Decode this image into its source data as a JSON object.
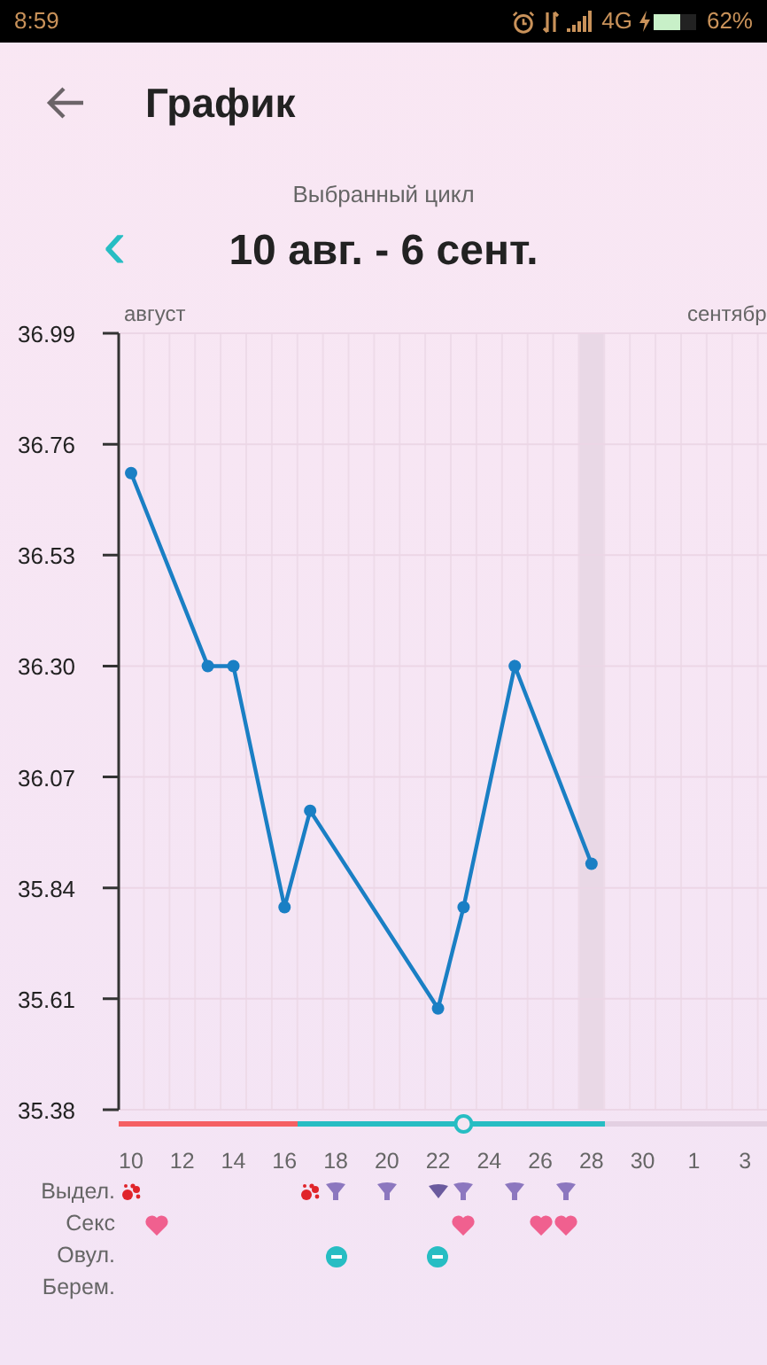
{
  "status_bar": {
    "time": "8:59",
    "network": "4G",
    "battery": "62%"
  },
  "header": {
    "title": "График"
  },
  "cycle": {
    "caption": "Выбранный цикл",
    "range": "10 авг. - 6 сент.",
    "prev": "‹"
  },
  "graph": {
    "month_labels": [
      "август",
      "сентябр"
    ],
    "chart_data": {
      "type": "line",
      "categories": [
        "10",
        null,
        "12",
        null,
        "14",
        null,
        "16",
        null,
        "18",
        null,
        "20",
        null,
        "22",
        null,
        "24",
        null,
        "26",
        null,
        "28",
        null,
        "30",
        null,
        "1",
        null,
        "3"
      ],
      "grid": true,
      "series": [
        {
          "color": "#1a7fc4",
          "marker": true,
          "values": [
            36.7,
            null,
            null,
            36.3,
            36.3,
            null,
            35.8,
            36.0,
            null,
            null,
            null,
            null,
            35.59,
            35.8,
            null,
            36.3,
            null,
            null,
            35.89,
            null,
            null,
            null,
            null,
            null,
            null
          ]
        }
      ],
      "ylim": [
        35.38,
        36.99
      ],
      "yticks": [
        {
          "value": 36.99,
          "label": "36.99"
        },
        {
          "value": 36.76,
          "label": "36.76"
        },
        {
          "value": 36.53,
          "label": "36.53"
        },
        {
          "value": 36.3,
          "label": "36.30"
        },
        {
          "value": 36.07,
          "label": "36.07"
        },
        {
          "value": 35.84,
          "label": "35.84"
        },
        {
          "value": 35.61,
          "label": "35.61"
        },
        {
          "value": 35.38,
          "label": "35.38"
        }
      ]
    },
    "cycle_bar": {
      "segments": [
        {
          "color": "#27bdc3",
          "level": 0.75
        },
        {
          "color": "#f55f63",
          "level": 0.276
        }
      ],
      "marker": {
        "level": 0.532
      }
    }
  },
  "symbol_rows": [
    {
      "label": "Выдел.",
      "cells": [
        {
          "kind": "blood"
        },
        {
          "kind": "empty"
        },
        {
          "kind": "empty"
        },
        {
          "kind": "empty"
        },
        {
          "kind": "empty"
        },
        {
          "kind": "empty"
        },
        {
          "kind": "empty"
        },
        {
          "kind": "blood"
        },
        {
          "kind": "drop"
        },
        {
          "kind": "empty"
        },
        {
          "kind": "drop"
        },
        {
          "kind": "empty"
        },
        {
          "kind": "drop_dark"
        },
        {
          "kind": "drop"
        },
        {
          "kind": "empty"
        },
        {
          "kind": "drop"
        },
        {
          "kind": "empty"
        },
        {
          "kind": "drop"
        }
      ]
    },
    {
      "label": "Секс",
      "cells": [
        {
          "kind": "empty"
        },
        {
          "kind": "heart"
        },
        {
          "kind": "empty"
        },
        {
          "kind": "empty"
        },
        {
          "kind": "empty"
        },
        {
          "kind": "empty"
        },
        {
          "kind": "empty"
        },
        {
          "kind": "empty"
        },
        {
          "kind": "empty"
        },
        {
          "kind": "empty"
        },
        {
          "kind": "empty"
        },
        {
          "kind": "empty"
        },
        {
          "kind": "empty"
        },
        {
          "kind": "heart"
        },
        {
          "kind": "empty"
        },
        {
          "kind": "empty"
        },
        {
          "kind": "heart"
        },
        {
          "kind": "heart"
        }
      ]
    },
    {
      "label": "Овул.",
      "cells": [
        {
          "kind": "empty"
        },
        {
          "kind": "empty"
        },
        {
          "kind": "empty"
        },
        {
          "kind": "empty"
        },
        {
          "kind": "empty"
        },
        {
          "kind": "empty"
        },
        {
          "kind": "empty"
        },
        {
          "kind": "empty"
        },
        {
          "kind": "ovulation"
        },
        {
          "kind": "empty"
        },
        {
          "kind": "empty"
        },
        {
          "kind": "empty"
        },
        {
          "kind": "ovulation"
        }
      ]
    },
    {
      "label": "Берем."
    }
  ]
}
